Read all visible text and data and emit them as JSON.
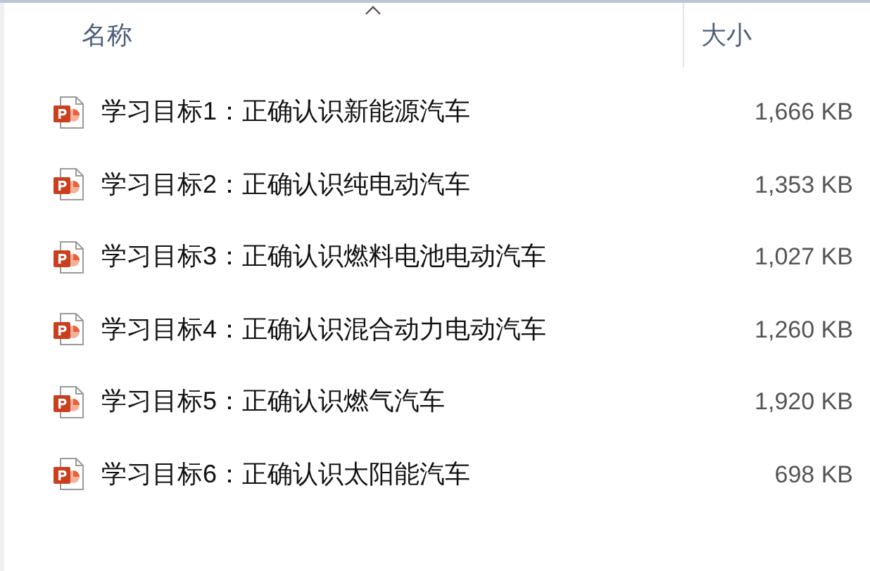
{
  "columns": [
    {
      "label": "名称",
      "sorted": true
    },
    {
      "label": "大小",
      "sorted": false
    }
  ],
  "files": [
    {
      "name": "学习目标1：正确认识新能源汽车",
      "size": "1,666 KB"
    },
    {
      "name": "学习目标2：正确认识纯电动汽车",
      "size": "1,353 KB"
    },
    {
      "name": "学习目标3：正确认识燃料电池电动汽车",
      "size": "1,027 KB"
    },
    {
      "name": "学习目标4：正确认识混合动力电动汽车",
      "size": "1,260 KB"
    },
    {
      "name": "学习目标5：正确认识燃气汽车",
      "size": "1,920 KB"
    },
    {
      "name": "学习目标6：正确认识太阳能汽车",
      "size": "698 KB"
    }
  ]
}
